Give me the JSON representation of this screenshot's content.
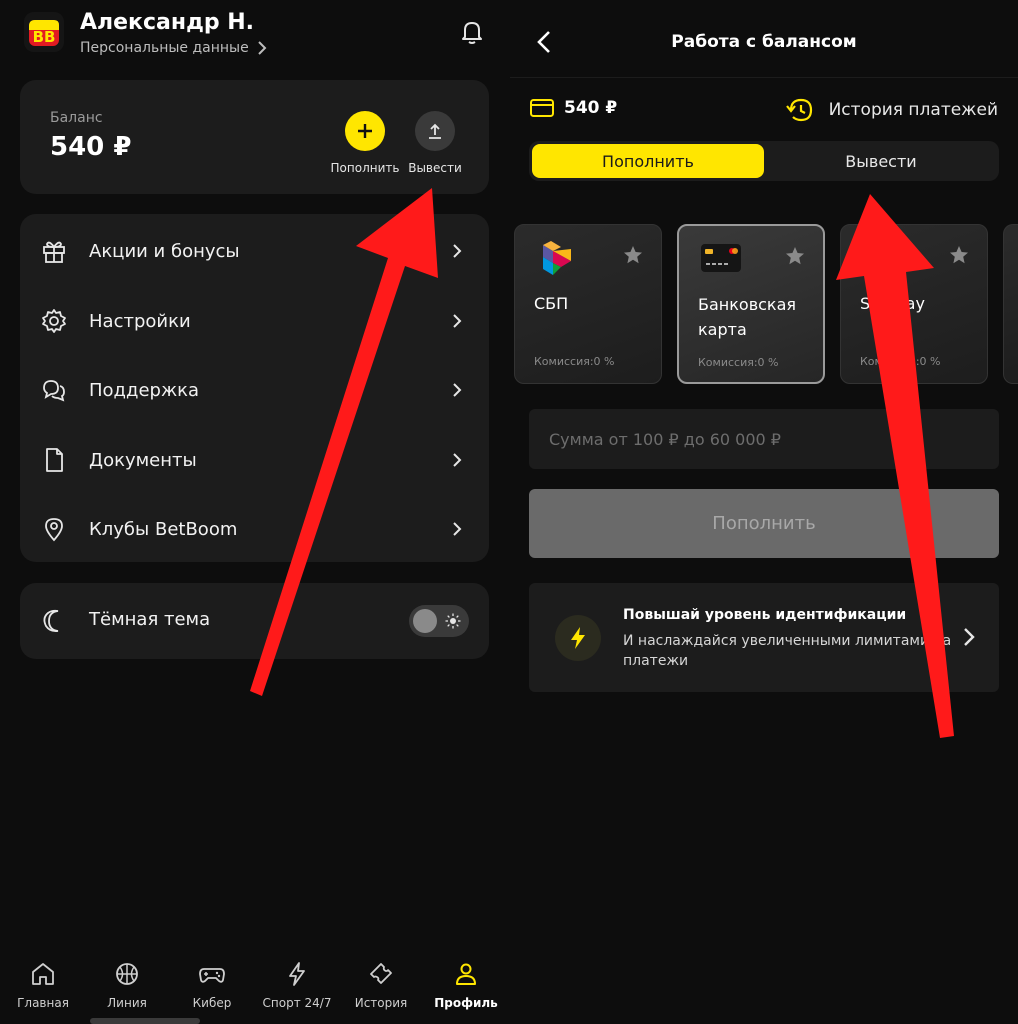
{
  "profile": {
    "name": "Александр Н.",
    "personal_link": "Персональные данные"
  },
  "balance": {
    "label": "Баланс",
    "value": "540 ₽",
    "topup_label": "Пополнить",
    "withdraw_label": "Вывести"
  },
  "menu": {
    "items": [
      {
        "label": "Акции и бонусы",
        "icon": "gift-icon"
      },
      {
        "label": "Настройки",
        "icon": "gear-icon"
      },
      {
        "label": "Поддержка",
        "icon": "chat-icon"
      },
      {
        "label": "Документы",
        "icon": "document-icon"
      },
      {
        "label": "Клубы BetBoom",
        "icon": "location-pin-icon"
      }
    ]
  },
  "theme": {
    "label": "Тёмная тема",
    "enabled": false
  },
  "nav": {
    "items": [
      {
        "label": "Главная",
        "icon": "home-icon"
      },
      {
        "label": "Линия",
        "icon": "ball-icon"
      },
      {
        "label": "Кибер",
        "icon": "gamepad-icon"
      },
      {
        "label": "Спорт 24/7",
        "icon": "lightning-icon"
      },
      {
        "label": "История",
        "icon": "ticket-icon"
      },
      {
        "label": "Профиль",
        "icon": "user-icon"
      }
    ],
    "active_index": 5
  },
  "balance_screen": {
    "title": "Работа с балансом",
    "balance_value": "540 ₽",
    "history_label": "История платежей",
    "tabs": {
      "topup": "Пополнить",
      "withdraw": "Вывести",
      "active": "topup"
    },
    "methods": [
      {
        "name": "СБП",
        "fee": "Комиссия:0 %",
        "icon": "sbp-logo-icon",
        "selected": false
      },
      {
        "name": "Банковская карта",
        "fee": "Комиссия:0 %",
        "icon": "bank-card-icon",
        "selected": true
      },
      {
        "name": "SberPay",
        "fee": "Комиссия:0 %",
        "icon": "sberpay-logo-icon",
        "selected": false
      }
    ],
    "amount_placeholder": "Сумма от 100 ₽ до 60 000 ₽",
    "submit_label": "Пополнить",
    "identification": {
      "title": "Повышай уровень идентификации",
      "text": "И наслаждайся увеличенными лимитами на платежи"
    }
  },
  "colors": {
    "accent": "#ffe600",
    "background": "#0d0d0d",
    "card": "#1c1c1c",
    "annotation_arrow": "#ff1a1a"
  }
}
